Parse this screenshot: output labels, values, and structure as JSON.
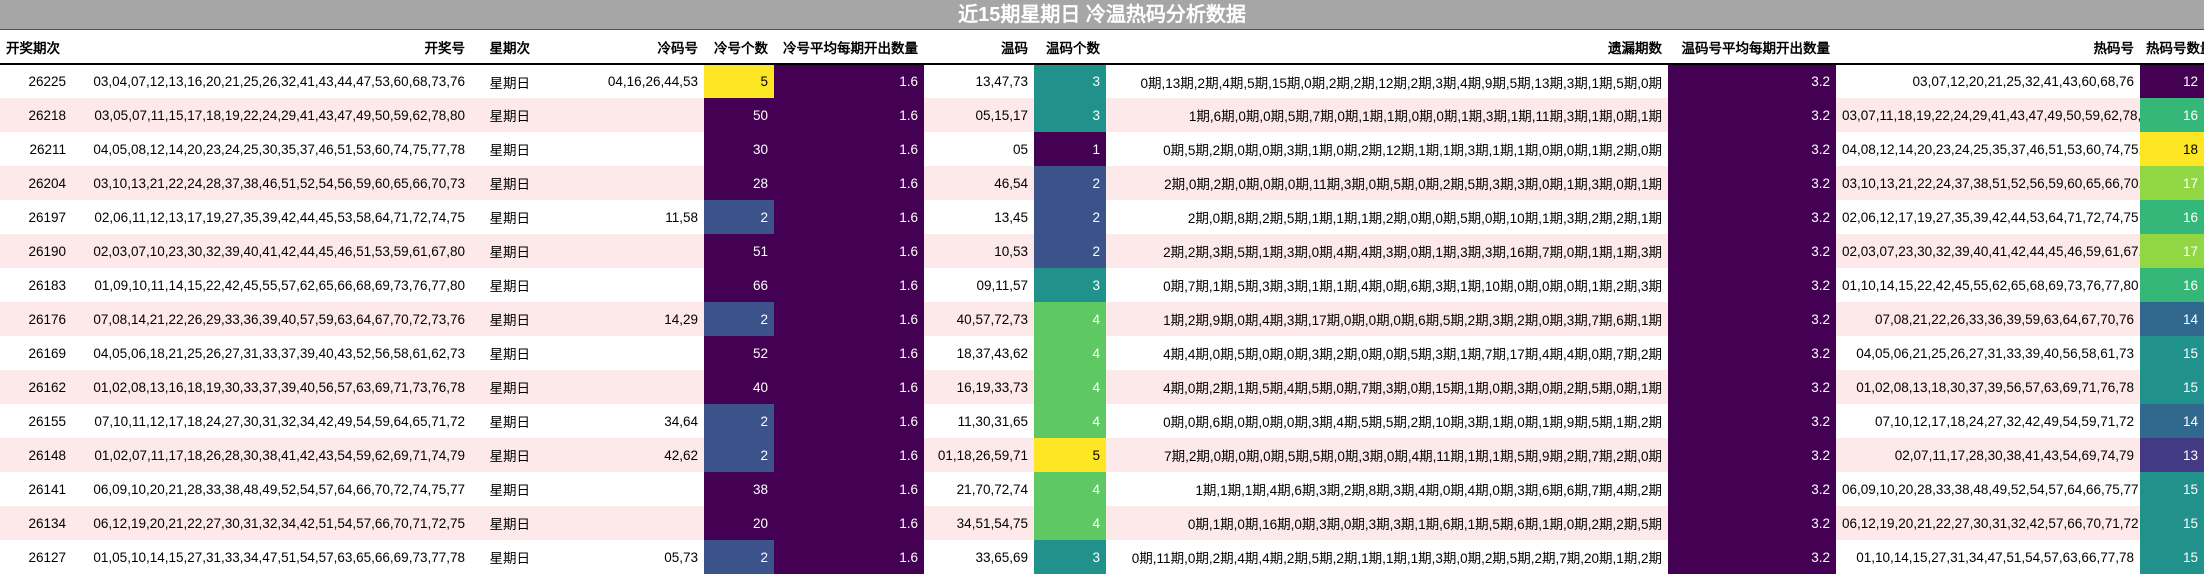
{
  "title": "近15期星期日 冷温热码分析数据",
  "headers": {
    "period": "开奖期次",
    "numbers": "开奖号",
    "weekday": "星期次",
    "cold_nums": "冷码号",
    "cold_count": "冷号个数",
    "cold_avg": "冷号平均每期开出数量",
    "warm_nums": "温码",
    "warm_count": "温码个数",
    "missing": "遗漏期数",
    "warm_avg": "温码号平均每期开出数量",
    "hot_nums": "热码号",
    "hot_count": "热码号数量"
  },
  "colors": {
    "count_1": "#440154",
    "count_2": "#3b528b",
    "count_3": "#21918c",
    "count_4": "#5ec962",
    "count_5": "#fde725",
    "count_50": "#440154",
    "hot_12": "#440154",
    "hot_13": "#443a83",
    "hot_14": "#31688e",
    "hot_15": "#21918c",
    "hot_16": "#35b779",
    "hot_17": "#90d743",
    "hot_18": "#fde725"
  },
  "rows": [
    {
      "period": "26225",
      "numbers": "03,04,07,12,13,16,20,21,25,26,32,41,43,44,47,53,60,68,73,76",
      "weekday": "星期日",
      "cold_nums": "04,16,26,44,53",
      "cold_count": "5",
      "cold_avg": "1.6",
      "warm_nums": "13,47,73",
      "warm_count": "3",
      "missing": "0期,13期,2期,4期,5期,15期,0期,2期,2期,12期,2期,3期,4期,9期,5期,13期,3期,1期,5期,0期",
      "warm_avg": "3.2",
      "hot_nums": "03,07,12,20,21,25,32,41,43,60,68,76",
      "hot_count": "12"
    },
    {
      "period": "26218",
      "numbers": "03,05,07,11,15,17,18,19,22,24,29,41,43,47,49,50,59,62,78,80",
      "weekday": "星期日",
      "cold_nums": "",
      "cold_count": "50",
      "cold_avg": "1.6",
      "warm_nums": "05,15,17",
      "warm_count": "3",
      "missing": "1期,6期,0期,0期,5期,7期,0期,1期,1期,0期,0期,1期,3期,1期,11期,3期,1期,0期,1期",
      "warm_avg": "3.2",
      "hot_nums": "03,07,11,18,19,22,24,29,41,43,47,49,50,59,62,78,80",
      "hot_count": "16"
    },
    {
      "period": "26211",
      "numbers": "04,05,08,12,14,20,23,24,25,30,35,37,46,51,53,60,74,75,77,78",
      "weekday": "星期日",
      "cold_nums": "",
      "cold_count": "30",
      "cold_avg": "1.6",
      "warm_nums": "05",
      "warm_count": "1",
      "missing": "0期,5期,2期,0期,0期,3期,1期,0期,2期,12期,1期,1期,3期,1期,1期,0期,0期,1期,2期,0期",
      "warm_avg": "3.2",
      "hot_nums": "04,08,12,14,20,23,24,25,35,37,46,51,53,60,74,75,77,78",
      "hot_count": "18"
    },
    {
      "period": "26204",
      "numbers": "03,10,13,21,22,24,28,37,38,46,51,52,54,56,59,60,65,66,70,73",
      "weekday": "星期日",
      "cold_nums": "",
      "cold_count": "28",
      "cold_avg": "1.6",
      "warm_nums": "46,54",
      "warm_count": "2",
      "missing": "2期,0期,2期,0期,0期,0期,11期,3期,0期,5期,0期,2期,5期,3期,3期,0期,1期,3期,0期,1期",
      "warm_avg": "3.2",
      "hot_nums": "03,10,13,21,22,24,37,38,51,52,56,59,60,65,66,70,73",
      "hot_count": "17"
    },
    {
      "period": "26197",
      "numbers": "02,06,11,12,13,17,19,27,35,39,42,44,45,53,58,64,71,72,74,75",
      "weekday": "星期日",
      "cold_nums": "11,58",
      "cold_count": "2",
      "cold_avg": "1.6",
      "warm_nums": "13,45",
      "warm_count": "2",
      "missing": "2期,0期,8期,2期,5期,1期,1期,1期,2期,0期,0期,5期,0期,10期,1期,3期,2期,2期,1期",
      "warm_avg": "3.2",
      "hot_nums": "02,06,12,17,19,27,35,39,42,44,53,64,71,72,74,75",
      "hot_count": "16"
    },
    {
      "period": "26190",
      "numbers": "02,03,07,10,23,30,32,39,40,41,42,44,45,46,51,53,59,61,67,80",
      "weekday": "星期日",
      "cold_nums": "",
      "cold_count": "51",
      "cold_avg": "1.6",
      "warm_nums": "10,53",
      "warm_count": "2",
      "missing": "2期,2期,3期,5期,1期,3期,0期,4期,4期,3期,0期,1期,3期,3期,16期,7期,0期,1期,1期,3期",
      "warm_avg": "3.2",
      "hot_nums": "02,03,07,23,30,32,39,40,41,42,44,45,46,59,61,67,80",
      "hot_count": "17"
    },
    {
      "period": "26183",
      "numbers": "01,09,10,11,14,15,22,42,45,55,57,62,65,66,68,69,73,76,77,80",
      "weekday": "星期日",
      "cold_nums": "",
      "cold_count": "66",
      "cold_avg": "1.6",
      "warm_nums": "09,11,57",
      "warm_count": "3",
      "missing": "0期,7期,1期,5期,3期,3期,1期,1期,4期,0期,6期,3期,1期,10期,0期,0期,0期,1期,2期,3期",
      "warm_avg": "3.2",
      "hot_nums": "01,10,14,15,22,42,45,55,62,65,68,69,73,76,77,80",
      "hot_count": "16"
    },
    {
      "period": "26176",
      "numbers": "07,08,14,21,22,26,29,33,36,39,40,57,59,63,64,67,70,72,73,76",
      "weekday": "星期日",
      "cold_nums": "14,29",
      "cold_count": "2",
      "cold_avg": "1.6",
      "warm_nums": "40,57,72,73",
      "warm_count": "4",
      "missing": "1期,2期,9期,0期,4期,3期,17期,0期,0期,0期,6期,5期,2期,3期,2期,0期,3期,7期,6期,1期",
      "warm_avg": "3.2",
      "hot_nums": "07,08,21,22,26,33,36,39,59,63,64,67,70,76",
      "hot_count": "14"
    },
    {
      "period": "26169",
      "numbers": "04,05,06,18,21,25,26,27,31,33,37,39,40,43,52,56,58,61,62,73",
      "weekday": "星期日",
      "cold_nums": "",
      "cold_count": "52",
      "cold_avg": "1.6",
      "warm_nums": "18,37,43,62",
      "warm_count": "4",
      "missing": "4期,4期,0期,5期,0期,0期,3期,2期,0期,0期,5期,3期,1期,7期,17期,4期,4期,0期,7期,2期",
      "warm_avg": "3.2",
      "hot_nums": "04,05,06,21,25,26,27,31,33,39,40,56,58,61,73",
      "hot_count": "15"
    },
    {
      "period": "26162",
      "numbers": "01,02,08,13,16,18,19,30,33,37,39,40,56,57,63,69,71,73,76,78",
      "weekday": "星期日",
      "cold_nums": "",
      "cold_count": "40",
      "cold_avg": "1.6",
      "warm_nums": "16,19,33,73",
      "warm_count": "4",
      "missing": "4期,0期,2期,1期,5期,4期,5期,0期,7期,3期,0期,15期,1期,0期,3期,0期,2期,5期,0期,1期",
      "warm_avg": "3.2",
      "hot_nums": "01,02,08,13,18,30,37,39,56,57,63,69,71,76,78",
      "hot_count": "15"
    },
    {
      "period": "26155",
      "numbers": "07,10,11,12,17,18,24,27,30,31,32,34,42,49,54,59,64,65,71,72",
      "weekday": "星期日",
      "cold_nums": "34,64",
      "cold_count": "2",
      "cold_avg": "1.6",
      "warm_nums": "11,30,31,65",
      "warm_count": "4",
      "missing": "0期,0期,6期,0期,0期,0期,3期,4期,5期,5期,2期,10期,3期,1期,0期,1期,9期,5期,1期,2期",
      "warm_avg": "3.2",
      "hot_nums": "07,10,12,17,18,24,27,32,42,49,54,59,71,72",
      "hot_count": "14"
    },
    {
      "period": "26148",
      "numbers": "01,02,07,11,17,18,26,28,30,38,41,42,43,54,59,62,69,71,74,79",
      "weekday": "星期日",
      "cold_nums": "42,62",
      "cold_count": "2",
      "cold_avg": "1.6",
      "warm_nums": "01,18,26,59,71",
      "warm_count": "5",
      "missing": "7期,2期,0期,0期,0期,5期,5期,0期,3期,0期,4期,11期,1期,1期,5期,9期,2期,7期,2期,0期",
      "warm_avg": "3.2",
      "hot_nums": "02,07,11,17,28,30,38,41,43,54,69,74,79",
      "hot_count": "13"
    },
    {
      "period": "26141",
      "numbers": "06,09,10,20,21,28,33,38,48,49,52,54,57,64,66,70,72,74,75,77",
      "weekday": "星期日",
      "cold_nums": "",
      "cold_count": "38",
      "cold_avg": "1.6",
      "warm_nums": "21,70,72,74",
      "warm_count": "4",
      "missing": "1期,1期,1期,4期,6期,3期,2期,8期,3期,4期,0期,4期,0期,3期,6期,6期,7期,4期,2期",
      "warm_avg": "3.2",
      "hot_nums": "06,09,10,20,28,33,38,48,49,52,54,57,64,66,75,77",
      "hot_count": "15"
    },
    {
      "period": "26134",
      "numbers": "06,12,19,20,21,22,27,30,31,32,34,42,51,54,57,66,70,71,72,75",
      "weekday": "星期日",
      "cold_nums": "",
      "cold_count": "20",
      "cold_avg": "1.6",
      "warm_nums": "34,51,54,75",
      "warm_count": "4",
      "missing": "0期,1期,0期,16期,0期,3期,0期,3期,3期,1期,6期,1期,5期,6期,1期,0期,2期,2期,5期",
      "warm_avg": "3.2",
      "hot_nums": "06,12,19,20,21,22,27,30,31,32,42,57,66,70,71,72",
      "hot_count": "15"
    },
    {
      "period": "26127",
      "numbers": "01,05,10,14,15,27,31,33,34,47,51,54,57,63,65,66,69,73,77,78",
      "weekday": "星期日",
      "cold_nums": "05,73",
      "cold_count": "2",
      "cold_avg": "1.6",
      "warm_nums": "33,65,69",
      "warm_count": "3",
      "missing": "0期,11期,0期,2期,4期,4期,2期,5期,2期,1期,1期,1期,3期,0期,2期,5期,2期,7期,20期,1期,2期",
      "warm_avg": "3.2",
      "hot_nums": "01,10,14,15,27,31,34,47,51,54,57,63,66,77,78",
      "hot_count": "15"
    }
  ]
}
